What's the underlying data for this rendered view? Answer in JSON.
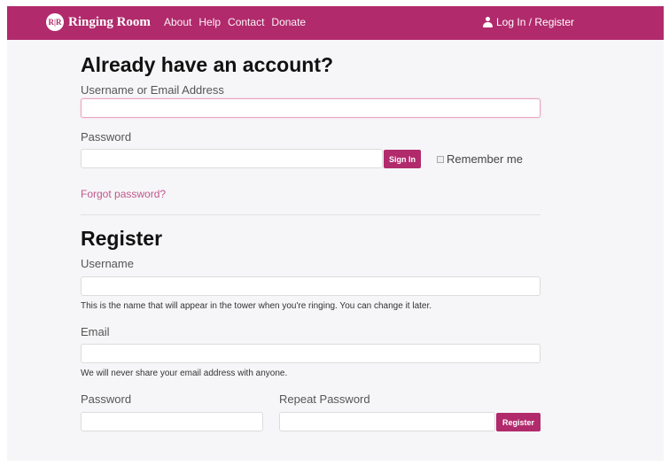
{
  "nav": {
    "logo_text": "R|R",
    "brand": "Ringing Room",
    "links": [
      "About",
      "Help",
      "Contact",
      "Donate"
    ],
    "login_label": "Log In / Register"
  },
  "login": {
    "heading": "Already have an account?",
    "username_label": "Username or Email Address",
    "password_label": "Password",
    "sign_in_button": "Sign In",
    "remember_label": "Remember me",
    "forgot_link": "Forgot password?"
  },
  "register": {
    "heading": "Register",
    "username_label": "Username",
    "username_hint": "This is the name that will appear in the tower when you're ringing. You can change it later.",
    "email_label": "Email",
    "email_hint": "We will never share your email address with anyone.",
    "password_label": "Password",
    "repeat_password_label": "Repeat Password",
    "register_button": "Register"
  },
  "colors": {
    "brand": "#b12a6c",
    "link": "#c0578c"
  }
}
